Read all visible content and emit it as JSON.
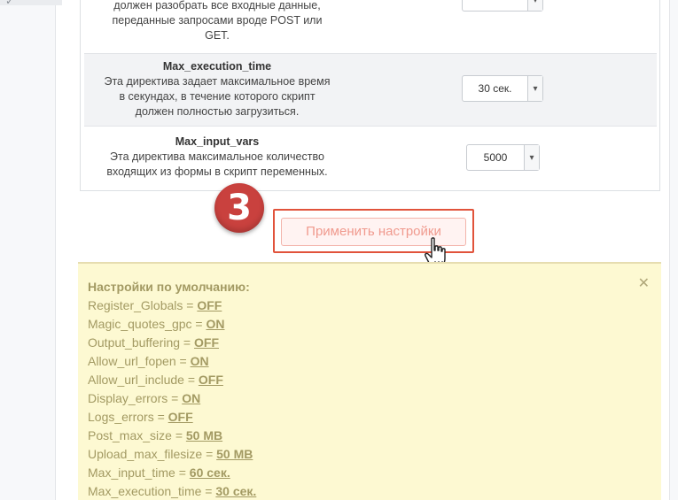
{
  "top_partial": {
    "lines": [
      "должен разобрать все входные данные,",
      "переданные запросами вроде POST или",
      "GET."
    ]
  },
  "settings": [
    {
      "title": "Max_execution_time",
      "description": [
        "Эта директива задает максимальное время",
        "в секундах, в течение которого скрипт",
        "должен полностью загрузиться."
      ],
      "value": "30 сек."
    },
    {
      "title": "Max_input_vars",
      "description": [
        "Эта директива максимальное количество",
        "входящих из формы в скрипт переменных."
      ],
      "value": "5000"
    }
  ],
  "step_badge": "3",
  "apply_button_label": "Применить настройки",
  "defaults": {
    "heading": "Настройки по умолчанию:",
    "items": [
      {
        "key": "Register_Globals = ",
        "value": "OFF"
      },
      {
        "key": "Magic_quotes_gpc = ",
        "value": "ON"
      },
      {
        "key": "Output_buffering = ",
        "value": "OFF"
      },
      {
        "key": "Allow_url_fopen = ",
        "value": "ON"
      },
      {
        "key": "Allow_url_include = ",
        "value": "OFF"
      },
      {
        "key": "Display_errors = ",
        "value": "ON"
      },
      {
        "key": "Logs_errors = ",
        "value": "OFF"
      },
      {
        "key": "Post_max_size = ",
        "value": "50 MB"
      },
      {
        "key": "Upload_max_filesize = ",
        "value": "50 MB"
      },
      {
        "key": "Max_input_time = ",
        "value": "60 сек."
      },
      {
        "key": "Max_execution_time = ",
        "value": "30 сек."
      }
    ],
    "close_glyph": "✕"
  },
  "icons": {
    "select_arrow": "▾",
    "top_icons": [
      "✓",
      "ℤ",
      "☐",
      "▾",
      "☐",
      "☐"
    ]
  },
  "colors": {
    "badge": "#c9413e",
    "apply_outline": "#e1533b",
    "defaults_bg": "#fdf9d2",
    "defaults_text": "#a39a63"
  }
}
